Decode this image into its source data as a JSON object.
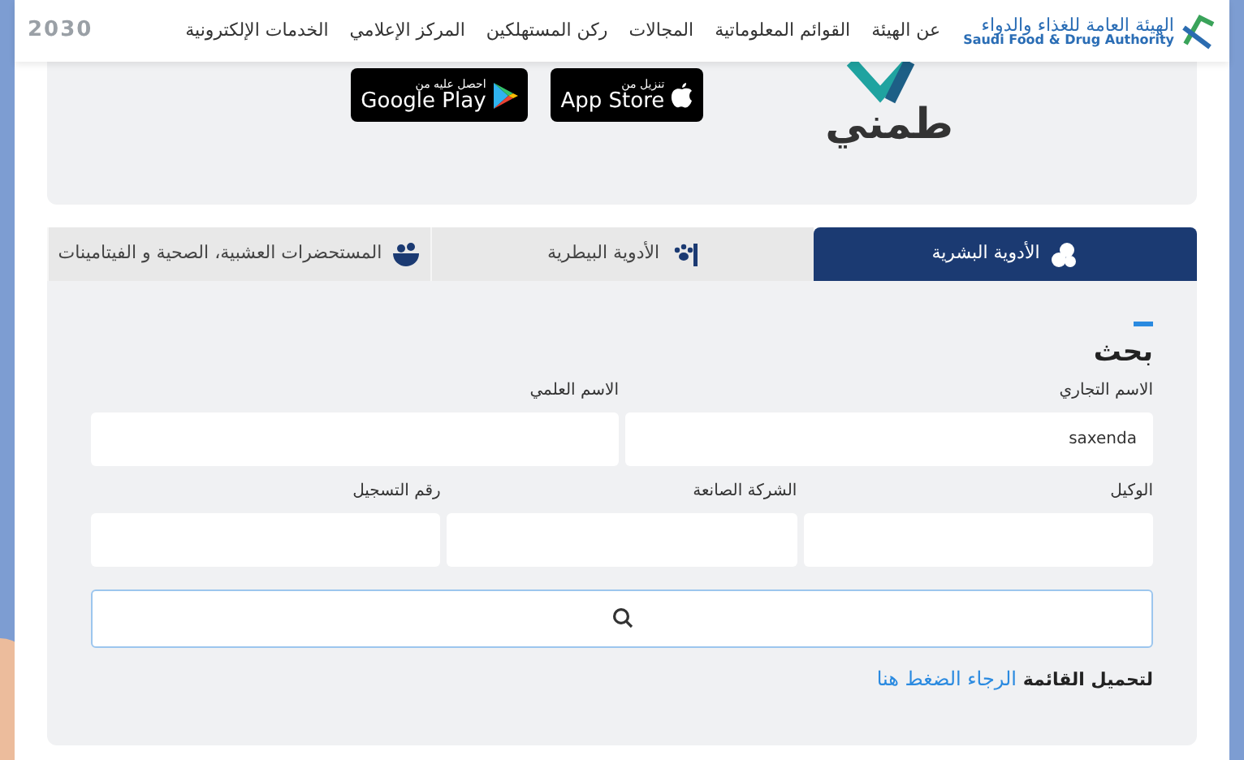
{
  "header": {
    "logo_ar": "الهيئة العامة للغذاء والدواء",
    "logo_en": "Saudi Food & Drug Authority",
    "nav": [
      "عن الهيئة",
      "القوائم المعلوماتية",
      "المجالات",
      "ركن المستهلكين",
      "المركز الإعلامي",
      "الخدمات الإلكترونية"
    ],
    "vision": "2030"
  },
  "app_banner": {
    "brand": "طمني",
    "badges": [
      {
        "kind": "apple",
        "small": "تنزيل من",
        "label": "App Store"
      },
      {
        "kind": "google",
        "small": "احصل عليه من",
        "label": "Google Play"
      }
    ]
  },
  "tabs": [
    {
      "kind": "pills",
      "label": "الأدوية البشرية",
      "selected": true
    },
    {
      "kind": "veterinary",
      "label": "الأدوية البيطرية",
      "selected": false
    },
    {
      "kind": "herbal",
      "label": "المستحضرات العشبية، الصحية و الفيتامينات",
      "selected": false
    }
  ],
  "search": {
    "title": "بحث",
    "rows": [
      [
        {
          "label": "الاسم التجاري",
          "value": "saxenda"
        },
        {
          "label": "الاسم العلمي"
        }
      ],
      [
        {
          "label": "الوكيل"
        },
        {
          "label": "الشركة الصانعة"
        },
        {
          "label": "رقم التسجيل"
        }
      ]
    ]
  },
  "download": {
    "text": "لتحميل القائمة",
    "link": "الرجاء الضغط هنا"
  }
}
